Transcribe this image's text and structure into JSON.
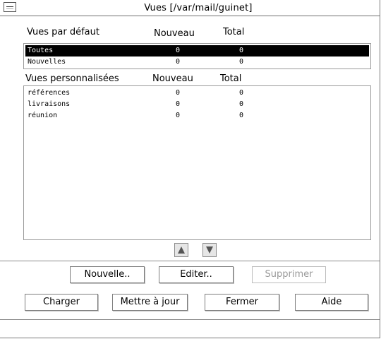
{
  "window": {
    "title": "Vues [/var/mail/guinet]"
  },
  "default_views": {
    "heading": "Vues par défaut",
    "col_new": "Nouveau",
    "col_total": "Total",
    "rows": [
      {
        "name": "Toutes",
        "new": "0",
        "total": "0",
        "selected": true
      },
      {
        "name": "Nouvelles",
        "new": "0",
        "total": "0",
        "selected": false
      }
    ]
  },
  "custom_views": {
    "heading": "Vues personnalisées",
    "col_new": "Nouveau",
    "col_total": "Total",
    "rows": [
      {
        "name": "références",
        "new": "0",
        "total": "0"
      },
      {
        "name": "livraisons",
        "new": "0",
        "total": "0"
      },
      {
        "name": "réunion",
        "new": "0",
        "total": "0"
      }
    ]
  },
  "buttons": {
    "new": "Nouvelle..",
    "edit": "Editer..",
    "delete": "Supprimer",
    "load": "Charger",
    "update": "Mettre à jour",
    "close": "Fermer",
    "help": "Aide"
  },
  "icons": {
    "move_up": "up-arrow-icon",
    "move_down": "down-arrow-icon",
    "window_menu": "window-menu-icon"
  }
}
